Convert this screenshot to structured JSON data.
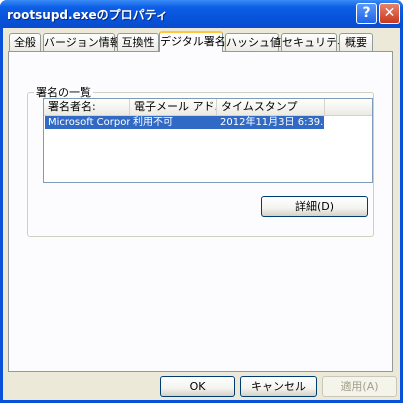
{
  "window": {
    "title": "rootsupd.exeのプロパティ"
  },
  "titlebar_buttons": {
    "help": "?",
    "close": "✕"
  },
  "tabs": [
    {
      "label": "全般"
    },
    {
      "label": "バージョン情報"
    },
    {
      "label": "互換性"
    },
    {
      "label": "デジタル署名",
      "active": true
    },
    {
      "label": "ハッシュ値"
    },
    {
      "label": "セキュリティ"
    },
    {
      "label": "概要"
    }
  ],
  "signature_list": {
    "group_label": "署名の一覧",
    "columns": [
      "署名者名:",
      "電子メール アド...",
      "タイムスタンプ"
    ],
    "rows": [
      {
        "signer": "Microsoft Corpor...",
        "email": "利用不可",
        "timestamp": "2012年11月3日 6:39..."
      }
    ]
  },
  "details_button": "詳細(D)",
  "footer": {
    "ok": "OK",
    "cancel": "キャンセル",
    "apply": "適用(A)"
  },
  "colors": {
    "title_bar": "#0652d8",
    "selection": "#316ac5",
    "active_tab_accent": "#ffc83c"
  }
}
